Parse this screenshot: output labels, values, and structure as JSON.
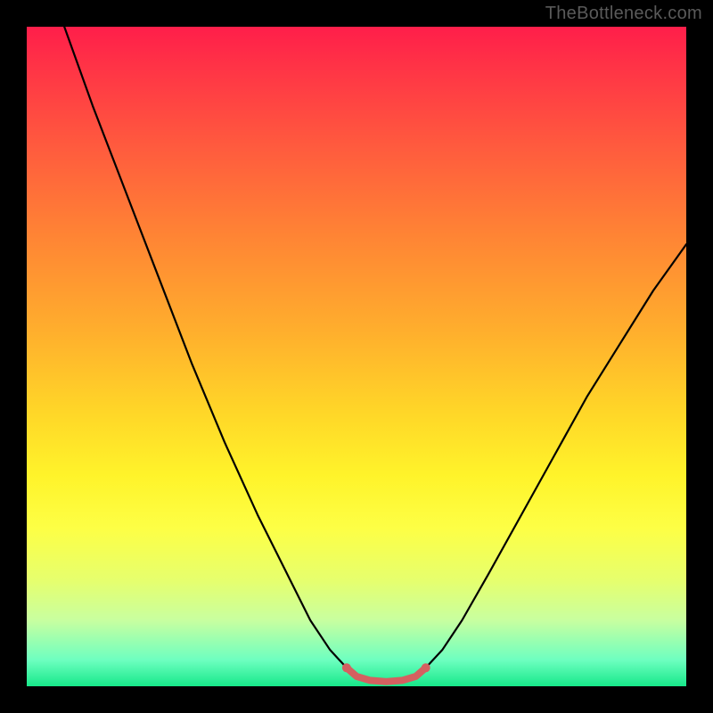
{
  "watermark": "TheBottleneck.com",
  "chart_data": {
    "type": "line",
    "title": "",
    "xlabel": "",
    "ylabel": "",
    "xlim": [
      0,
      100
    ],
    "ylim": [
      0,
      100
    ],
    "gradient_stops": [
      {
        "pos": 0,
        "color": "#ff1e4a"
      },
      {
        "pos": 6,
        "color": "#ff3346"
      },
      {
        "pos": 18,
        "color": "#ff5a3e"
      },
      {
        "pos": 32,
        "color": "#ff8534"
      },
      {
        "pos": 46,
        "color": "#ffae2d"
      },
      {
        "pos": 58,
        "color": "#ffd528"
      },
      {
        "pos": 68,
        "color": "#fff32a"
      },
      {
        "pos": 76,
        "color": "#fdff45"
      },
      {
        "pos": 84,
        "color": "#e6ff6e"
      },
      {
        "pos": 90,
        "color": "#c8ffa0"
      },
      {
        "pos": 96,
        "color": "#6effc0"
      },
      {
        "pos": 100,
        "color": "#17e88a"
      }
    ],
    "series": [
      {
        "name": "left-branch",
        "stroke": "#000000",
        "width": 2.2,
        "points": [
          {
            "x": 5.7,
            "y": 100
          },
          {
            "x": 10,
            "y": 88
          },
          {
            "x": 15,
            "y": 75
          },
          {
            "x": 20,
            "y": 62
          },
          {
            "x": 25,
            "y": 49
          },
          {
            "x": 30,
            "y": 37
          },
          {
            "x": 35,
            "y": 26
          },
          {
            "x": 40,
            "y": 16
          },
          {
            "x": 43,
            "y": 10
          },
          {
            "x": 46,
            "y": 5.5
          },
          {
            "x": 48.5,
            "y": 2.8
          }
        ]
      },
      {
        "name": "right-branch",
        "stroke": "#000000",
        "width": 2.2,
        "points": [
          {
            "x": 60.5,
            "y": 2.8
          },
          {
            "x": 63,
            "y": 5.5
          },
          {
            "x": 66,
            "y": 10
          },
          {
            "x": 70,
            "y": 17
          },
          {
            "x": 75,
            "y": 26
          },
          {
            "x": 80,
            "y": 35
          },
          {
            "x": 85,
            "y": 44
          },
          {
            "x": 90,
            "y": 52
          },
          {
            "x": 95,
            "y": 60
          },
          {
            "x": 100,
            "y": 67
          }
        ]
      },
      {
        "name": "bottom-fill",
        "stroke": "#d46060",
        "width": 8,
        "points": [
          {
            "x": 48.5,
            "y": 2.8
          },
          {
            "x": 50,
            "y": 1.5
          },
          {
            "x": 52,
            "y": 0.9
          },
          {
            "x": 54.5,
            "y": 0.7
          },
          {
            "x": 57,
            "y": 0.9
          },
          {
            "x": 59,
            "y": 1.5
          },
          {
            "x": 60.5,
            "y": 2.8
          }
        ]
      }
    ]
  }
}
